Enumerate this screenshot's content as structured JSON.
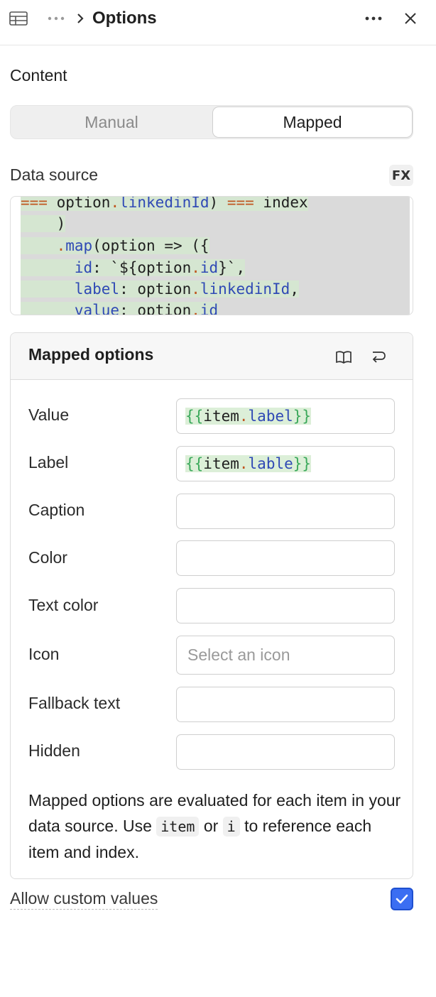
{
  "header": {
    "title": "Options"
  },
  "content": {
    "section_title": "Content",
    "segments": [
      "Manual",
      "Mapped"
    ],
    "selected_segment": "Mapped",
    "data_source": {
      "label": "Data source",
      "fx_label": "FX",
      "code_lines": [
        "=== option.linkedinId) === index",
        "    )",
        "    .map(option => ({",
        "      id: `${option.id}`,",
        "      label: option.linkedinId,",
        "      value: option.id"
      ]
    }
  },
  "mapped_options": {
    "title": "Mapped options",
    "rows": [
      {
        "label": "Value",
        "value": "{{item.label}}",
        "placeholder": ""
      },
      {
        "label": "Label",
        "value": "{{item.lable}}",
        "placeholder": ""
      },
      {
        "label": "Caption",
        "value": "",
        "placeholder": ""
      },
      {
        "label": "Color",
        "value": "",
        "placeholder": ""
      },
      {
        "label": "Text color",
        "value": "",
        "placeholder": ""
      },
      {
        "label": "Icon",
        "value": "",
        "placeholder": "Select an icon"
      },
      {
        "label": "Fallback text",
        "value": "",
        "placeholder": ""
      },
      {
        "label": "Hidden",
        "value": "",
        "placeholder": ""
      }
    ],
    "help_text_1": "Mapped options are evaluated for each item in your data source. Use",
    "help_code_1": "item",
    "help_text_2": "or",
    "help_code_2": "i",
    "help_text_3": "to reference each item and index."
  },
  "allow_custom": {
    "label": "Allow custom values",
    "checked": true
  },
  "colors": {
    "accent": "#3b6ef2",
    "code_highlight": "#d5e6d1",
    "keyword": "#c0561f",
    "property": "#2f49b5",
    "brace": "#3aa85a"
  }
}
